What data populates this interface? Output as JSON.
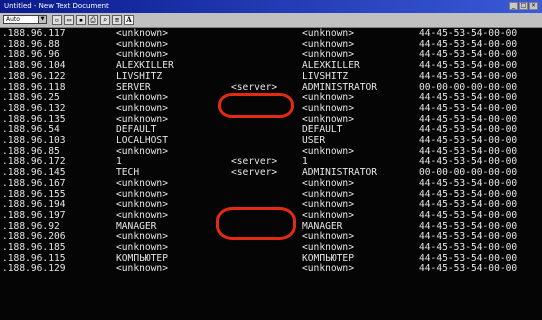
{
  "window": {
    "title": "Untitled - New Text Document"
  },
  "toolbar": {
    "font_value": "Auto",
    "bold_glyph": "A"
  },
  "rows": [
    {
      "ip": ".188.96.117",
      "name": "<unknown>",
      "srv": "",
      "user": "<unknown>",
      "mac": "44-45-53-54-00-00"
    },
    {
      "ip": ".188.96.88",
      "name": "<unknown>",
      "srv": "",
      "user": "<unknown>",
      "mac": "44-45-53-54-00-00"
    },
    {
      "ip": ".188.96.96",
      "name": "<unknown>",
      "srv": "",
      "user": "<unknown>",
      "mac": "44-45-53-54-00-00"
    },
    {
      "ip": ".188.96.104",
      "name": "ALEXKILLER",
      "srv": "",
      "user": "ALEXKILLER",
      "mac": "44-45-53-54-00-00"
    },
    {
      "ip": ".188.96.122",
      "name": "LIVSHITZ",
      "srv": "",
      "user": "LIVSHITZ",
      "mac": "44-45-53-54-00-00"
    },
    {
      "ip": ".188.96.118",
      "name": "SERVER",
      "srv": "<server>",
      "user": "ADMINISTRATOR",
      "mac": "00-00-00-00-00-00"
    },
    {
      "ip": ".188.96.25",
      "name": "<unknown>",
      "srv": "",
      "user": "<unknown>",
      "mac": "44-45-53-54-00-00"
    },
    {
      "ip": ".188.96.132",
      "name": "<unknown>",
      "srv": "",
      "user": "<unknown>",
      "mac": "44-45-53-54-00-00"
    },
    {
      "ip": ".188.96.135",
      "name": "<unknown>",
      "srv": "",
      "user": "<unknown>",
      "mac": "44-45-53-54-00-00"
    },
    {
      "ip": ".188.96.54",
      "name": "DEFAULT",
      "srv": "",
      "user": "DEFAULT",
      "mac": "44-45-53-54-00-00"
    },
    {
      "ip": ".188.96.103",
      "name": "LOCALHOST",
      "srv": "",
      "user": "USER",
      "mac": "44-45-53-54-00-00"
    },
    {
      "ip": ".188.96.85",
      "name": "<unknown>",
      "srv": "",
      "user": "<unknown>",
      "mac": "44-45-53-54-00-00"
    },
    {
      "ip": ".188.96.172",
      "name": "1",
      "srv": "<server>",
      "user": "1",
      "mac": "44-45-53-54-00-00"
    },
    {
      "ip": ".188.96.145",
      "name": "TECH",
      "srv": "<server>",
      "user": "ADMINISTRATOR",
      "mac": "00-00-00-00-00-00"
    },
    {
      "ip": ".188.96.167",
      "name": "<unknown>",
      "srv": "",
      "user": "<unknown>",
      "mac": "44-45-53-54-00-00"
    },
    {
      "ip": ".188.96.155",
      "name": "<unknown>",
      "srv": "",
      "user": "<unknown>",
      "mac": "44-45-53-54-00-00"
    },
    {
      "ip": ".188.96.194",
      "name": "<unknown>",
      "srv": "",
      "user": "<unknown>",
      "mac": "44-45-53-54-00-00"
    },
    {
      "ip": ".188.96.197",
      "name": "<unknown>",
      "srv": "",
      "user": "<unknown>",
      "mac": "44-45-53-54-00-00"
    },
    {
      "ip": ".188.96.92",
      "name": "MANAGER",
      "srv": "",
      "user": "MANAGER",
      "mac": "44-45-53-54-00-00"
    },
    {
      "ip": ".188.96.206",
      "name": "<unknown>",
      "srv": "",
      "user": "<unknown>",
      "mac": "44-45-53-54-00-00"
    },
    {
      "ip": ".188.96.185",
      "name": "<unknown>",
      "srv": "",
      "user": "<unknown>",
      "mac": "44-45-53-54-00-00"
    },
    {
      "ip": ".188.96.115",
      "name": "КОМПЬЮТЕР",
      "srv": "",
      "user": "КОМПЬЮТЕР",
      "mac": "44-45-53-54-00-00"
    },
    {
      "ip": ".188.96.129",
      "name": "<unknown>",
      "srv": "",
      "user": "<unknown>",
      "mac": "44-45-53-54-00-00"
    }
  ],
  "colors": {
    "console_bg": "#050505",
    "console_text": "#e6e6e6",
    "annotation": "#e32a12"
  },
  "icons": [
    "new-icon",
    "open-icon",
    "save-icon",
    "print-icon",
    "find-icon",
    "font-icon"
  ]
}
